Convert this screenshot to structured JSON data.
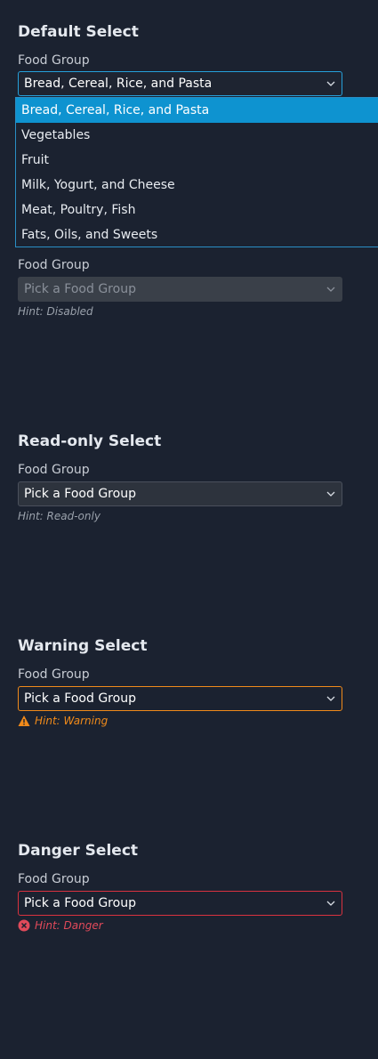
{
  "default_select": {
    "title": "Default Select",
    "label": "Food Group",
    "value": "Bread, Cereal, Rice, and Pasta",
    "options": [
      "Bread, Cereal, Rice, and Pasta",
      "Vegetables",
      "Fruit",
      "Milk, Yogurt, and Cheese",
      "Meat, Poultry, Fish",
      "Fats, Oils, and Sweets"
    ],
    "selected_option": "Bread, Cereal, Rice, and Pasta",
    "accent_color": "#0e93d0"
  },
  "disabled_select": {
    "label": "Food Group",
    "placeholder": "Pick a Food Group",
    "hint": "Hint: Disabled"
  },
  "readonly_select": {
    "title": "Read-only Select",
    "label": "Food Group",
    "placeholder": "Pick a Food Group",
    "hint": "Hint: Read-only"
  },
  "warning_select": {
    "title": "Warning Select",
    "label": "Food Group",
    "placeholder": "Pick a Food Group",
    "hint": "Hint: Warning",
    "icon": "warning-icon",
    "color": "#f08a1a"
  },
  "danger_select": {
    "title": "Danger Select",
    "label": "Food Group",
    "placeholder": "Pick a Food Group",
    "hint": "Hint: Danger",
    "icon": "error-icon",
    "color": "#d9323f"
  }
}
